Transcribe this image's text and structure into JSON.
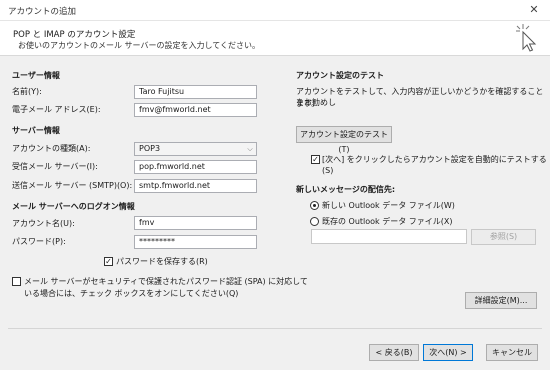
{
  "window": {
    "title": "アカウントの追加",
    "close": "✕"
  },
  "header": {
    "title": "POP と IMAP のアカウント設定",
    "subtitle": "お使いのアカウントのメール サーバーの設定を入力してください。"
  },
  "user_info": {
    "heading": "ユーザー情報",
    "name_label": "名前(Y):",
    "name_value": "Taro Fujitsu",
    "email_label": "電子メール アドレス(E):",
    "email_value": "fmv@fmworld.net"
  },
  "server_info": {
    "heading": "サーバー情報",
    "account_type_label": "アカウントの種類(A):",
    "account_type_value": "POP3",
    "incoming_label": "受信メール サーバー(I):",
    "incoming_value": "pop.fmworld.net",
    "outgoing_label": "送信メール サーバー (SMTP)(O):",
    "outgoing_value": "smtp.fmworld.net"
  },
  "logon_info": {
    "heading": "メール サーバーへのログオン情報",
    "account_name_label": "アカウント名(U):",
    "account_name_value": "fmv",
    "password_label": "パスワード(P):",
    "password_value": "*********",
    "remember_password": "パスワードを保存する(R)",
    "remember_checked": true
  },
  "spa": {
    "line1": "メール サーバーがセキュリティで保護されたパスワード認証 (SPA) に対応して",
    "line2": "いる場合には、チェック ボックスをオンにしてください(Q)",
    "checked": false
  },
  "account_test": {
    "heading": "アカウント設定のテスト",
    "desc1": "アカウントをテストして、入力内容が正しいかどうかを確認することをお勧めし",
    "desc2": "ます。",
    "test_button": "アカウント設定のテスト(T)",
    "auto_test_line1": "[次へ] をクリックしたらアカウント設定を自動的にテストする",
    "auto_test_line2": "(S)",
    "auto_test_checked": true
  },
  "deliver_to": {
    "heading": "新しいメッセージの配信先:",
    "new_file": "新しい Outlook データ ファイル(W)",
    "existing_file": "既存の Outlook データ ファイル(X)",
    "browse_button": "参照(S)",
    "selected": "new"
  },
  "more_settings_button": "詳細設定(M)...",
  "footer": {
    "back": "< 戻る(B)",
    "next": "次へ(N) >",
    "cancel": "キャンセル"
  }
}
